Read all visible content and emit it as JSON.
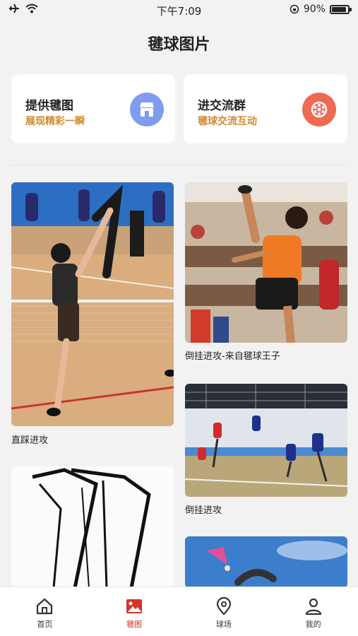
{
  "status": {
    "time": "下午7:09",
    "battery": "90%",
    "battery_level": 0.9
  },
  "page": {
    "title": "毽球图片"
  },
  "cards": [
    {
      "title": "提供毽图",
      "subtitle": "展现精彩一瞬",
      "icon": "store-icon",
      "color": "#7f9cf0"
    },
    {
      "title": "进交流群",
      "subtitle": "毽球交流互动",
      "icon": "group-icon",
      "color": "#ee6a52"
    }
  ],
  "photos": [
    {
      "caption": "直踩进攻"
    },
    {
      "caption": "倒挂进攻-来自毽球王子"
    },
    {
      "caption": "倒挂进攻"
    },
    {
      "caption": ""
    },
    {
      "caption": ""
    }
  ],
  "tabs": [
    {
      "label": "首页",
      "icon": "home-icon"
    },
    {
      "label": "毽图",
      "icon": "image-icon",
      "active": true
    },
    {
      "label": "球场",
      "icon": "location-pin-icon"
    },
    {
      "label": "我的",
      "icon": "user-icon"
    }
  ]
}
